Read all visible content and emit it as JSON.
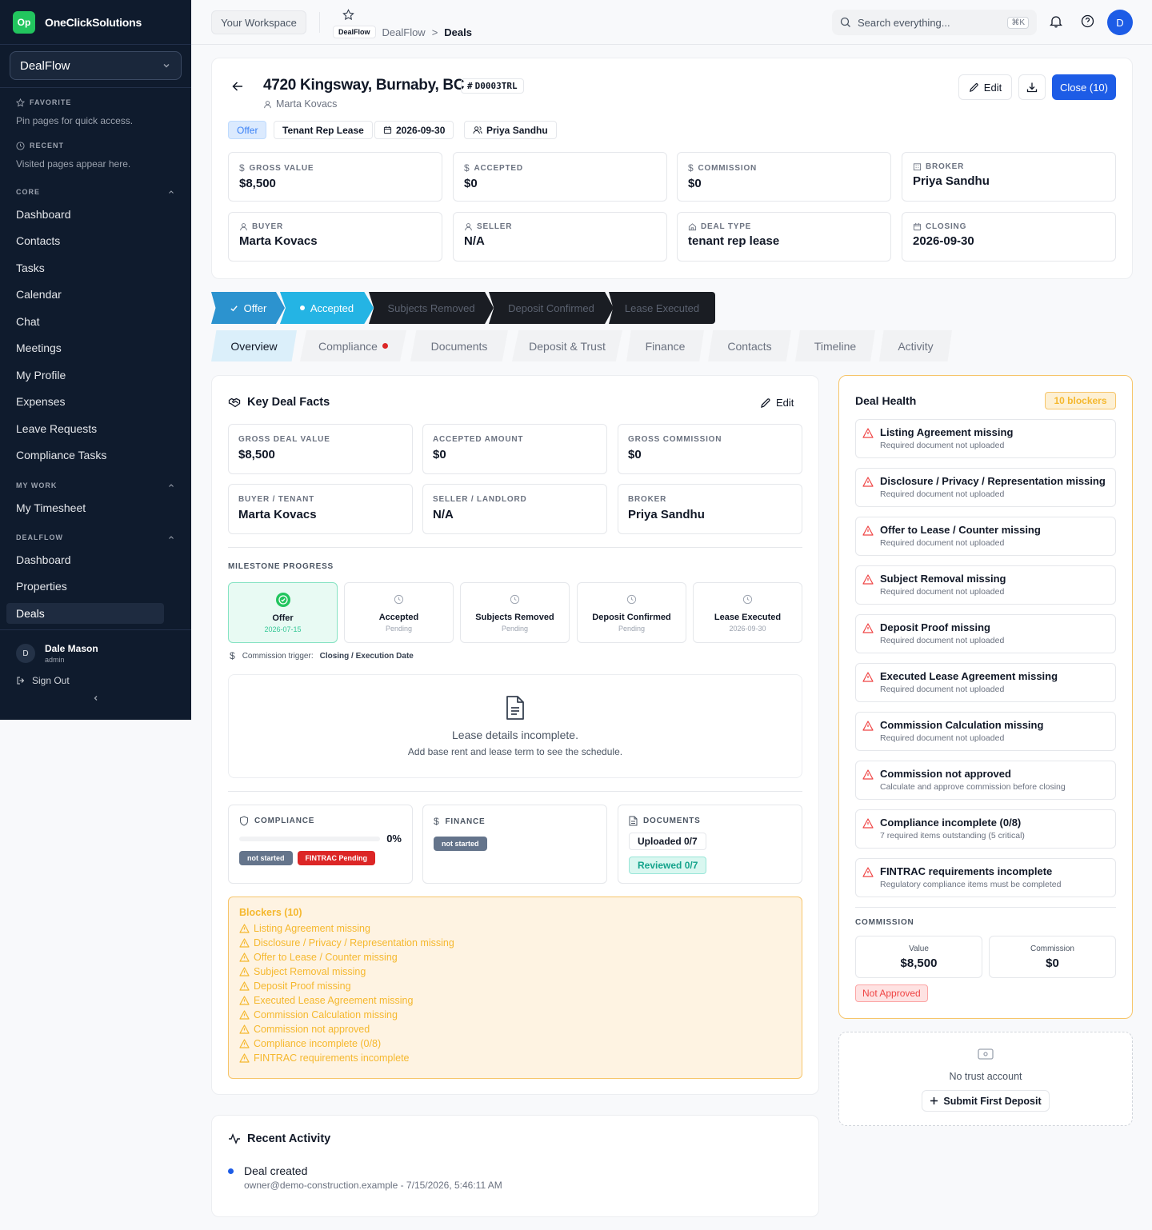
{
  "brand": {
    "logo": "Op",
    "name": "OneClickSolutions"
  },
  "sidebar": {
    "app": "DealFlow",
    "favorite_title": "FAVORITE",
    "favorite_hint": "Pin pages for quick access.",
    "recent_title": "RECENT",
    "recent_hint": "Visited pages appear here.",
    "groups": [
      {
        "title": "CORE",
        "items": [
          "Dashboard",
          "Contacts",
          "Tasks",
          "Calendar",
          "Chat",
          "Meetings",
          "My Profile",
          "Expenses",
          "Leave Requests",
          "Compliance Tasks"
        ]
      },
      {
        "title": "MY WORK",
        "items": [
          "My Timesheet"
        ]
      },
      {
        "title": "DEALFLOW",
        "items": [
          "Dashboard",
          "Properties",
          "Deals"
        ]
      }
    ],
    "user": {
      "initial": "D",
      "name": "Dale Mason",
      "role": "admin"
    },
    "sign_out": "Sign Out"
  },
  "topbar": {
    "workspace": "Your Workspace",
    "breadcrumb": {
      "badge": "DealFlow",
      "app": "DealFlow",
      "sep": ">",
      "page": "Deals"
    },
    "search_placeholder": "Search everything...",
    "search_kbd": "⌘K",
    "avatar": "D"
  },
  "deal": {
    "title": "4720 Kingsway, Burnaby, BC",
    "id": "D0003TRL",
    "owner": "Marta Kovacs",
    "chips": {
      "status": "Offer",
      "type": "Tenant Rep Lease",
      "date": "2026-09-30",
      "agent": "Priya Sandhu"
    },
    "buttons": {
      "edit": "Edit",
      "close": "Close (10)"
    },
    "stats": [
      {
        "label": "GROSS VALUE",
        "value": "$8,500",
        "icon": "dollar-icon"
      },
      {
        "label": "ACCEPTED",
        "value": "$0",
        "icon": "dollar-icon"
      },
      {
        "label": "COMMISSION",
        "value": "$0",
        "icon": "dollar-icon"
      },
      {
        "label": "BROKER",
        "value": "Priya Sandhu",
        "icon": "building-icon"
      },
      {
        "label": "BUYER",
        "value": "Marta Kovacs",
        "icon": "user-icon"
      },
      {
        "label": "SELLER",
        "value": "N/A",
        "icon": "user-icon"
      },
      {
        "label": "DEAL TYPE",
        "value": "tenant rep lease",
        "icon": "home-icon"
      },
      {
        "label": "CLOSING",
        "value": "2026-09-30",
        "icon": "calendar-icon"
      }
    ]
  },
  "stages": [
    "Offer",
    "Accepted",
    "Subjects Removed",
    "Deposit Confirmed",
    "Lease Executed"
  ],
  "tabs": [
    "Overview",
    "Compliance",
    "Documents",
    "Deposit & Trust",
    "Finance",
    "Contacts",
    "Timeline",
    "Activity"
  ],
  "facts": {
    "title": "Key Deal Facts",
    "edit": "Edit",
    "items": [
      {
        "label": "GROSS DEAL VALUE",
        "value": "$8,500"
      },
      {
        "label": "ACCEPTED AMOUNT",
        "value": "$0"
      },
      {
        "label": "GROSS COMMISSION",
        "value": "$0"
      },
      {
        "label": "BUYER / TENANT",
        "value": "Marta Kovacs"
      },
      {
        "label": "SELLER / LANDLORD",
        "value": "N/A"
      },
      {
        "label": "BROKER",
        "value": "Priya Sandhu"
      }
    ]
  },
  "milestones": {
    "title": "MILESTONE PROGRESS",
    "items": [
      {
        "name": "Offer",
        "status": "2026-07-15"
      },
      {
        "name": "Accepted",
        "status": "Pending"
      },
      {
        "name": "Subjects Removed",
        "status": "Pending"
      },
      {
        "name": "Deposit Confirmed",
        "status": "Pending"
      },
      {
        "name": "Lease Executed",
        "status": "2026-09-30"
      }
    ],
    "trigger_label": "Commission trigger:",
    "trigger_value": "Closing / Execution Date"
  },
  "lease": {
    "title": "Lease details incomplete.",
    "sub": "Add base rent and lease term to see the schedule."
  },
  "mini": {
    "compliance": {
      "title": "COMPLIANCE",
      "percent": "0%",
      "progress": 0,
      "pill1": "not started",
      "pill2": "FINTRAC Pending"
    },
    "finance": {
      "title": "FINANCE",
      "pill": "not started"
    },
    "documents": {
      "title": "DOCUMENTS",
      "uploaded": "Uploaded 0/7",
      "reviewed": "Reviewed 0/7"
    }
  },
  "blockers": {
    "title": "Blockers (10)",
    "items": [
      "Listing Agreement missing",
      "Disclosure / Privacy / Representation missing",
      "Offer to Lease / Counter missing",
      "Subject Removal missing",
      "Deposit Proof missing",
      "Executed Lease Agreement missing",
      "Commission Calculation missing",
      "Commission not approved",
      "Compliance incomplete (0/8)",
      "FINTRAC requirements incomplete"
    ]
  },
  "activity": {
    "title": "Recent Activity",
    "event": "Deal created",
    "meta": "owner@demo-construction.example - 7/15/2026, 5:46:11 AM"
  },
  "health": {
    "title": "Deal Health",
    "badge": "10 blockers",
    "items": [
      {
        "title": "Listing Agreement missing",
        "sub": "Required document not uploaded"
      },
      {
        "title": "Disclosure / Privacy / Representation missing",
        "sub": "Required document not uploaded"
      },
      {
        "title": "Offer to Lease / Counter missing",
        "sub": "Required document not uploaded"
      },
      {
        "title": "Subject Removal missing",
        "sub": "Required document not uploaded"
      },
      {
        "title": "Deposit Proof missing",
        "sub": "Required document not uploaded"
      },
      {
        "title": "Executed Lease Agreement missing",
        "sub": "Required document not uploaded"
      },
      {
        "title": "Commission Calculation missing",
        "sub": "Required document not uploaded"
      },
      {
        "title": "Commission not approved",
        "sub": "Calculate and approve commission before closing"
      },
      {
        "title": "Compliance incomplete (0/8)",
        "sub": "7 required items outstanding (5 critical)"
      },
      {
        "title": "FINTRAC requirements incomplete",
        "sub": "Regulatory compliance items must be completed"
      }
    ],
    "commission_title": "COMMISSION",
    "value_label": "Value",
    "value": "$8,500",
    "commission_label": "Commission",
    "commission": "$0",
    "status": "Not Approved"
  },
  "trust": {
    "empty": "No trust account",
    "button": "Submit First Deposit"
  },
  "colors": {
    "primary": "#1d5ce6",
    "stage_done": "#2c93cf",
    "stage_current": "#24b4e4",
    "stage_pending": "#1a1d23",
    "warning": "#f5b82e",
    "danger": "#dc2626"
  }
}
